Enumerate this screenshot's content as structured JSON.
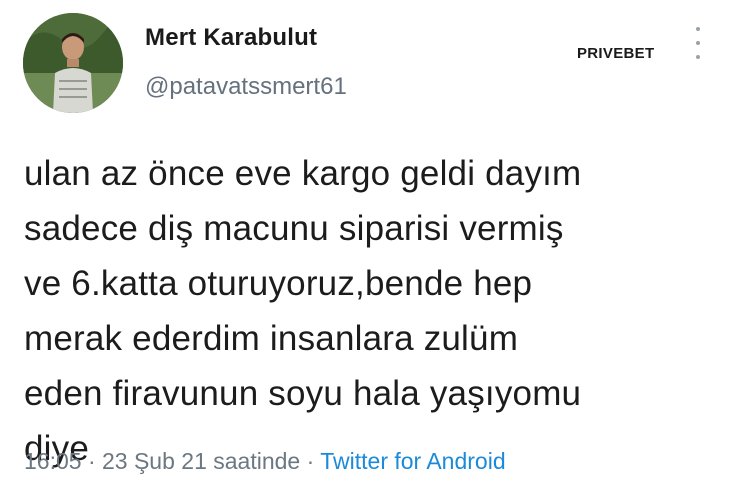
{
  "user": {
    "display_name": "Mert Karabulut",
    "handle": "@patavatssmert61",
    "avatar_icon": "user-photo-icon"
  },
  "watermark": "PRIVEBET",
  "menu_icon": "more-vertical-icon",
  "tweet": {
    "lines": [
      "ulan az önce eve kargo geldi dayım",
      "sadece diş macunu siparisi vermiş",
      "ve 6.katta oturuyoruz,bende hep",
      "merak ederdim insanlara zulüm",
      "eden firavunun soyu hala yaşıyomu",
      "diye"
    ]
  },
  "meta": {
    "timestamp": "16:05 · 23 Şub 21 saatinde",
    "separator": " · ",
    "source": "Twitter for Android"
  },
  "colors": {
    "handle": "#65727e",
    "link": "#1b8ad8"
  }
}
